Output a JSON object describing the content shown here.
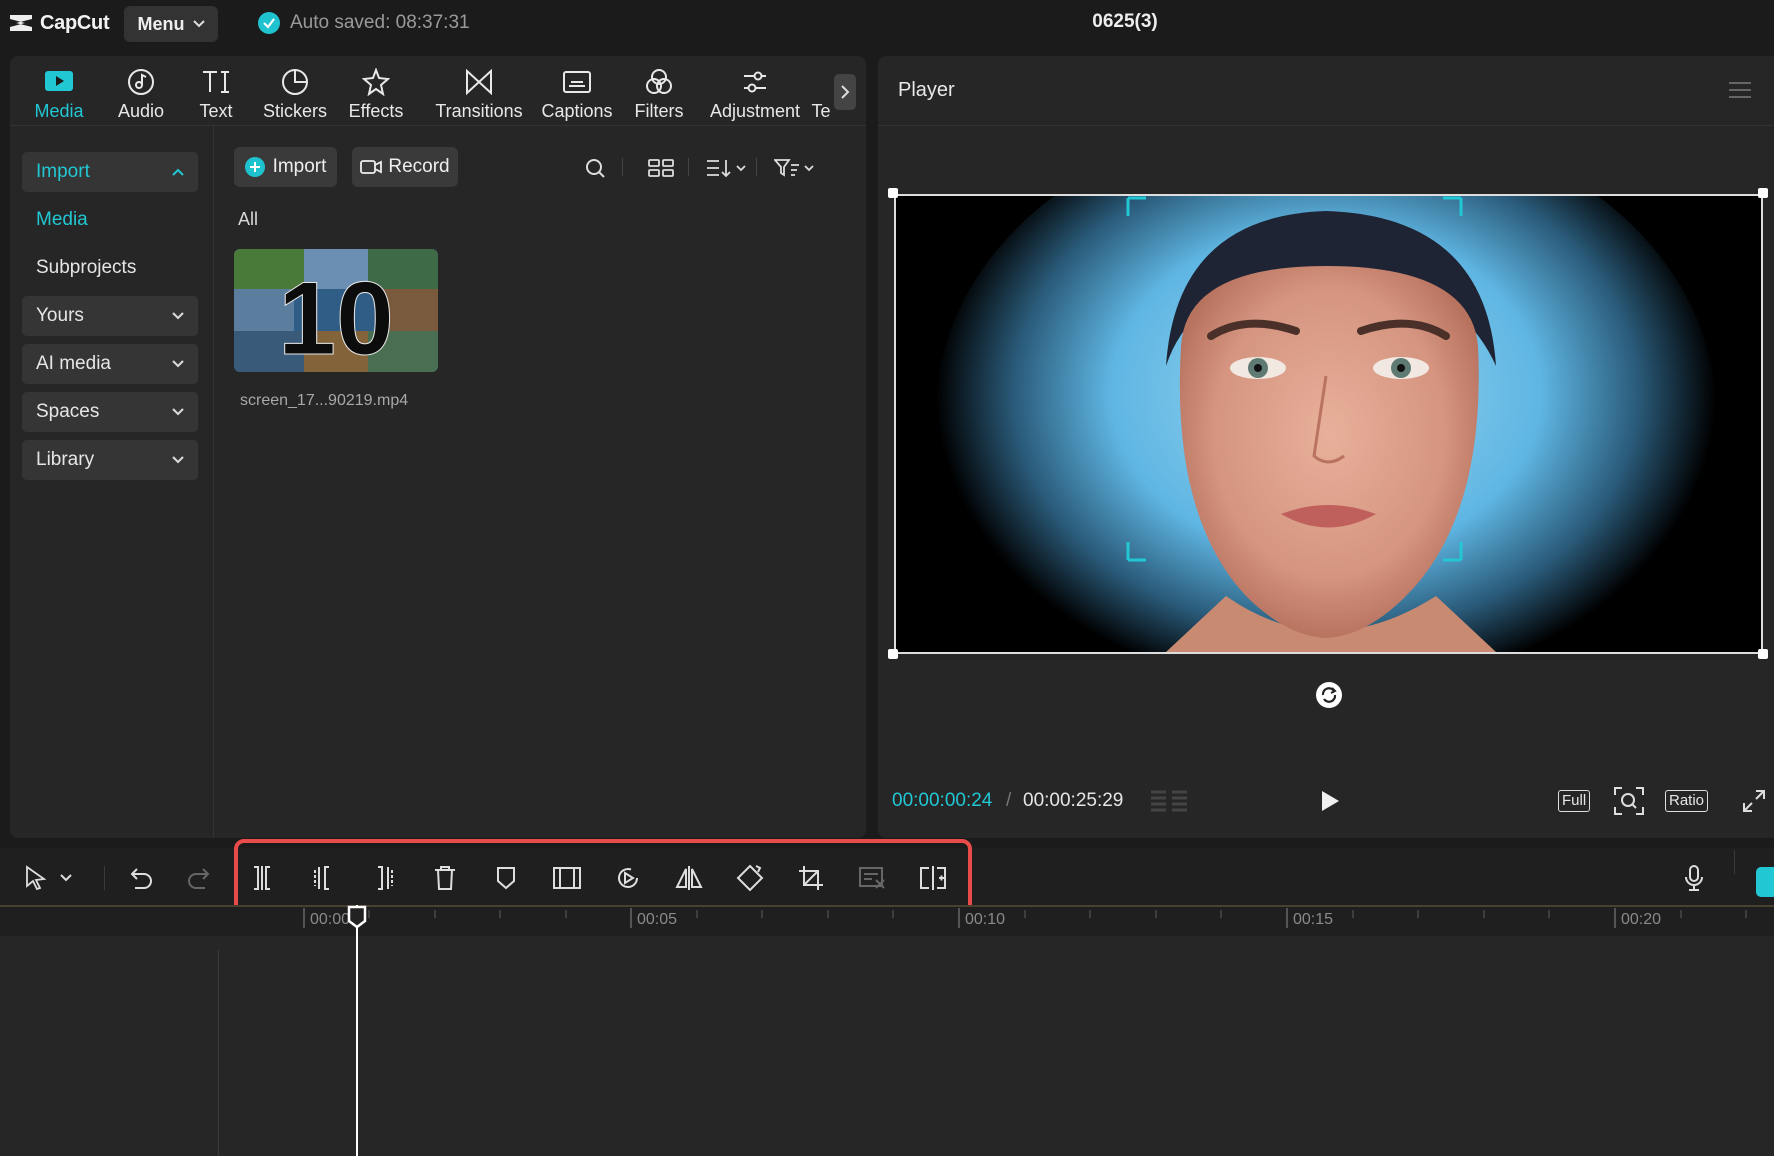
{
  "app": {
    "name": "CapCut",
    "menu_label": "Menu",
    "autosave_text": "Auto saved: 08:37:31",
    "project_title": "0625(3)"
  },
  "tool_tabs": [
    {
      "label": "Media",
      "icon": "media-icon",
      "active": true
    },
    {
      "label": "Audio",
      "icon": "audio-icon"
    },
    {
      "label": "Text",
      "icon": "text-icon"
    },
    {
      "label": "Stickers",
      "icon": "stickers-icon"
    },
    {
      "label": "Effects",
      "icon": "effects-icon"
    },
    {
      "label": "Transitions",
      "icon": "transitions-icon"
    },
    {
      "label": "Captions",
      "icon": "captions-icon"
    },
    {
      "label": "Filters",
      "icon": "filters-icon"
    },
    {
      "label": "Adjustment",
      "icon": "adjustment-icon"
    },
    {
      "label": "Te",
      "icon": ""
    }
  ],
  "side_nav": {
    "import": "Import",
    "media": "Media",
    "subprojects": "Subprojects",
    "yours": "Yours",
    "ai_media": "AI media",
    "spaces": "Spaces",
    "library": "Library"
  },
  "media": {
    "import_label": "Import",
    "record_label": "Record",
    "filter_all": "All",
    "items": [
      {
        "name": "screen_17...90219.mp4",
        "thumb_text": "10"
      }
    ]
  },
  "player": {
    "title": "Player",
    "current_time": "00:00:00:24",
    "separator": "/",
    "total_time": "00:00:25:29",
    "full_label": "Full",
    "ratio_label": "Ratio"
  },
  "timeline": {
    "ruler_labels": [
      "00:00",
      "00:05",
      "00:10",
      "00:15",
      "00:20"
    ],
    "toolbar_icons": [
      "select-icon",
      "undo-icon",
      "redo-icon",
      "split-icon",
      "delete-left-icon",
      "delete-right-icon",
      "delete-icon",
      "marker-icon",
      "freeze-frame-icon",
      "reverse-icon",
      "mirror-icon",
      "rotate-icon",
      "crop-icon",
      "remove-captions-icon",
      "replace-icon",
      "microphone-icon"
    ]
  },
  "colors": {
    "accent": "#22c7d4",
    "highlight": "#e94b4b",
    "panel": "#262626",
    "background": "#1b1b1b"
  }
}
